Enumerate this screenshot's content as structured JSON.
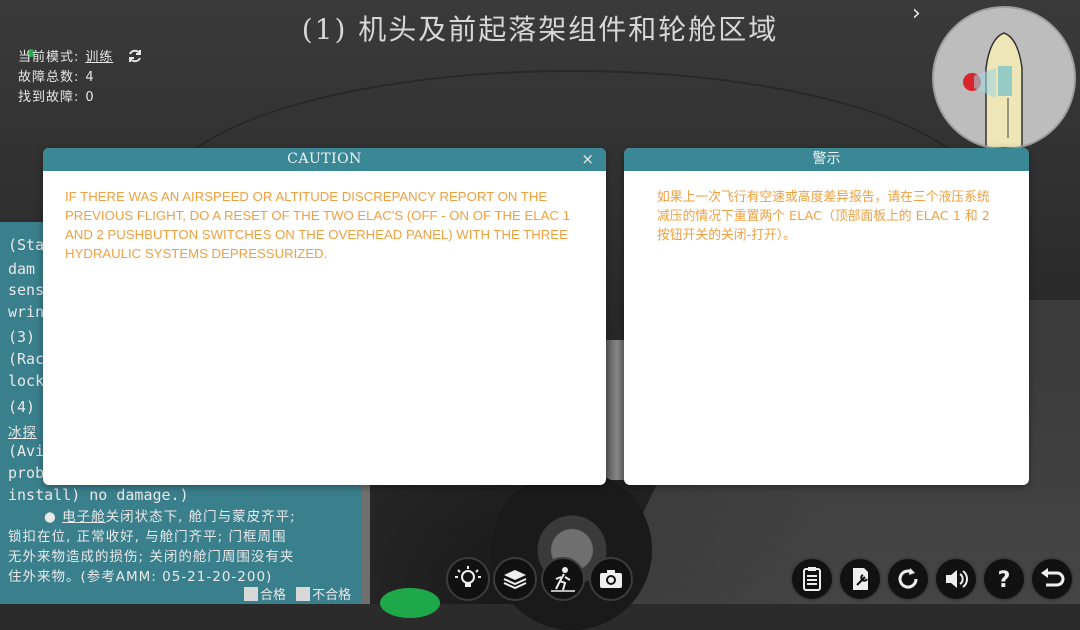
{
  "title": "(1) 机头及前起落架组件和轮舱区域",
  "info": {
    "mode_label": "当前模式:",
    "mode_value": "训练",
    "fault_total_label": "故障总数:",
    "fault_total_value": "4",
    "found_label": "找到故障:",
    "found_value": "0"
  },
  "task_panel": {
    "lines": [
      "(Sta",
      "dam",
      "sens",
      "wrin",
      " (3)",
      "(Rac",
      "lock",
      " (4)",
      "冰探",
      "(Avi",
      "prob",
      "install) no damage.)"
    ],
    "bullet_link": "电子舱",
    "bullet_text": "关闭状态下, 舱门与蒙皮齐平;",
    "para_lines": [
      "锁扣在位, 正常收好, 与舱门齐平; 门框周围",
      "无外来物造成的损伤; 关闭的舱门周围没有夹",
      "住外来物。(参考AMM: 05-21-20-200)"
    ],
    "pass_label": "合格",
    "fail_label": "不合格"
  },
  "caution_dialog": {
    "title": "CAUTION",
    "close": "×",
    "text": "IF THERE WAS AN AIRSPEED OR ALTITUDE DISCREPANCY REPORT ON THE PREVIOUS FLIGHT, DO A RESET OF THE TWO ELAC'S (OFF - ON OF THE ELAC 1 AND 2 PUSHBUTTON SWITCHES ON THE OVERHEAD PANEL) WITH THE THREE HYDRAULIC SYSTEMS DEPRESSURIZED."
  },
  "warning_dialog": {
    "title": "警示",
    "text": "如果上一次飞行有空速或高度差异报告，请在三个液压系统减压的情况下重置两个 ELAC（顶部面板上的 ELAC 1 和 2 按钮开关的关闭-打开）。"
  },
  "colors": {
    "dialog_header": "#3a8895",
    "dialog_text": "#f0a040",
    "panel_bg": "#3a7f8c"
  },
  "toolbar_left": [
    "lightbulb-icon",
    "layers-icon",
    "walk-icon",
    "camera-icon"
  ],
  "toolbar_right": [
    "clipboard-icon",
    "tool-manual-icon",
    "reset-icon",
    "volume-icon",
    "help-icon",
    "back-icon"
  ]
}
